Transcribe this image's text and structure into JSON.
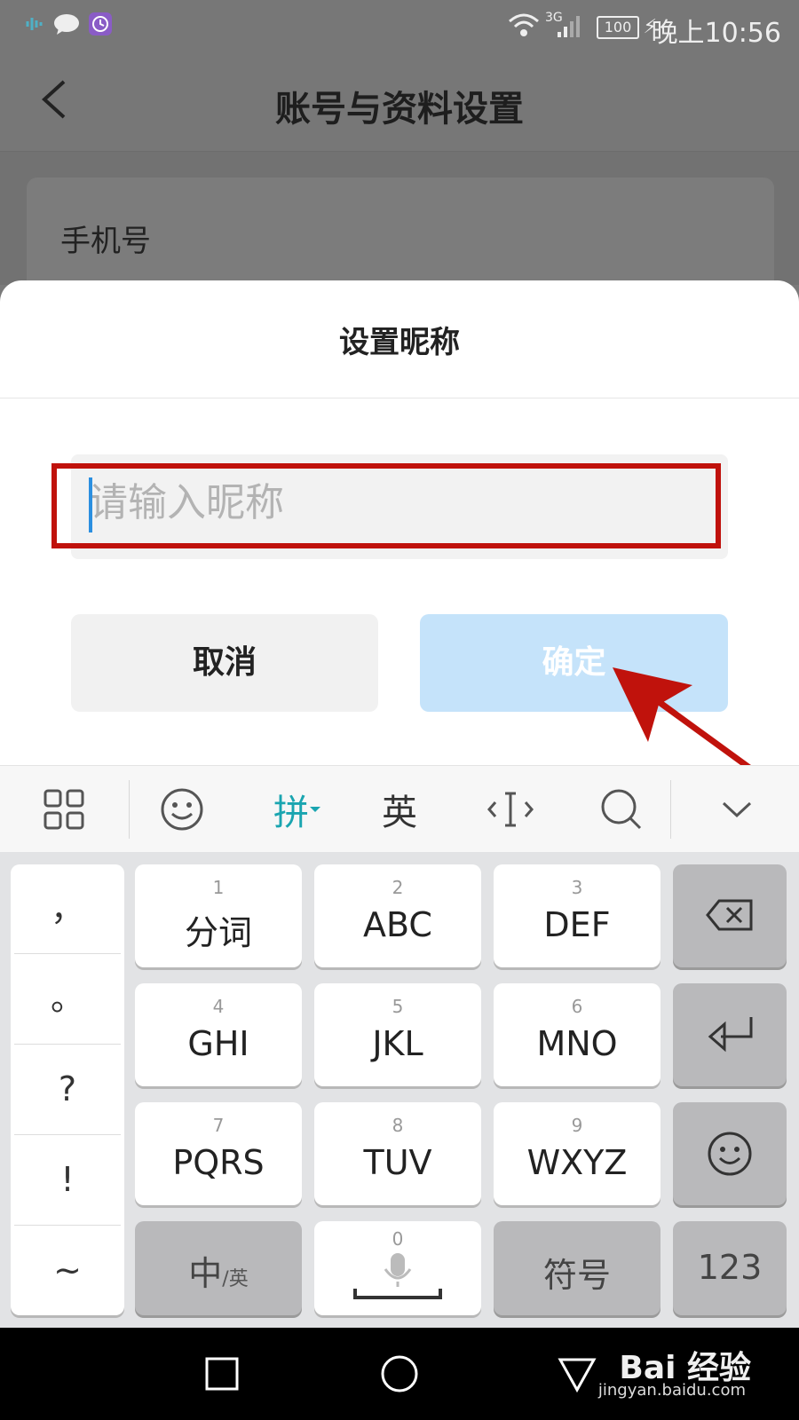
{
  "status_bar": {
    "time": "晚上10:56",
    "battery": "100",
    "network": "3G",
    "icons": [
      "audio-app-icon",
      "chat-app-icon",
      "clock-app-icon",
      "wifi-icon",
      "signal-icon",
      "battery-icon",
      "charging-icon"
    ]
  },
  "header": {
    "title": "账号与资料设置",
    "back_icon": "back-arrow-icon"
  },
  "content": {
    "phone_label": "手机号"
  },
  "dialog": {
    "title": "设置昵称",
    "input_placeholder": "请输入昵称",
    "input_value": "",
    "cancel_label": "取消",
    "confirm_label": "确定"
  },
  "keyboard_toolbar": {
    "items": [
      "grid-menu-icon",
      "emoji-icon",
      "拼",
      "英",
      "cursor-icon",
      "search-icon",
      "collapse-keyboard-icon"
    ],
    "pinyin_label": "拼",
    "english_label": "英",
    "active_color": "#1aa5b0"
  },
  "keyboard": {
    "punct": [
      "，",
      "。",
      "?",
      "!",
      "~"
    ],
    "keys": [
      {
        "num": "1",
        "label": "分词"
      },
      {
        "num": "2",
        "label": "ABC"
      },
      {
        "num": "3",
        "label": "DEF"
      },
      {
        "num": "4",
        "label": "GHI"
      },
      {
        "num": "5",
        "label": "JKL"
      },
      {
        "num": "6",
        "label": "MNO"
      },
      {
        "num": "7",
        "label": "PQRS"
      },
      {
        "num": "8",
        "label": "TUV"
      },
      {
        "num": "9",
        "label": "WXYZ"
      }
    ],
    "zh_en_main": "中",
    "zh_en_sub": "/英",
    "space_num": "0",
    "symbols_label": "符号",
    "numbers_label": "123"
  },
  "nav_bar": {
    "icons": [
      "recent-apps-icon",
      "home-icon",
      "back-triangle-icon"
    ]
  },
  "watermark": {
    "main": "Bai 经验",
    "sub": "jingyan.baidu.com"
  },
  "colors": {
    "highlight": "#c0120c",
    "confirm_button": "#c5e3fa",
    "caret": "#2b8fe0"
  }
}
